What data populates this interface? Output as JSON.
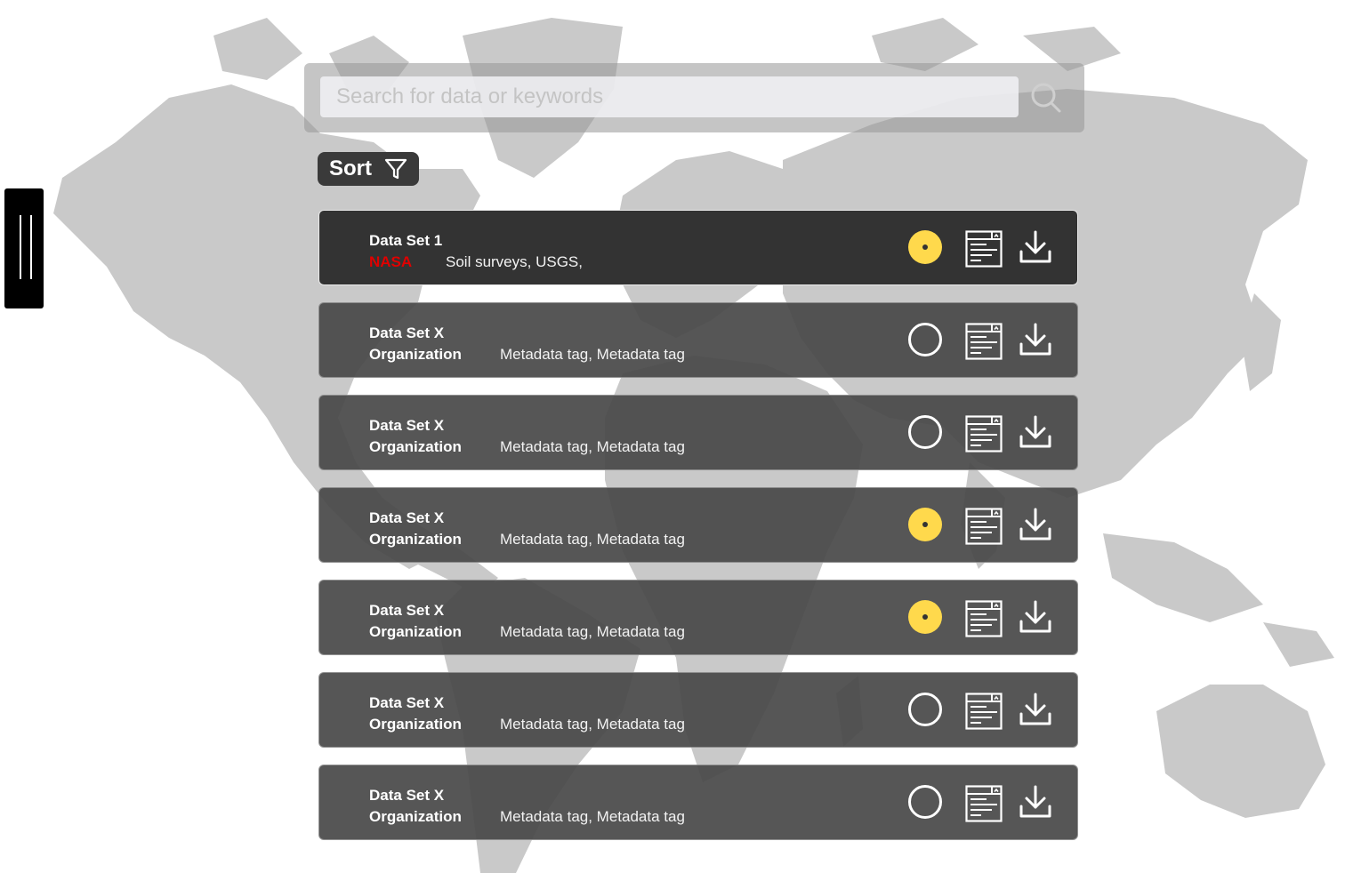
{
  "search": {
    "placeholder": "Search for data or keywords"
  },
  "sort": {
    "label": "Sort"
  },
  "colors": {
    "accent_selected": "#ffd94c",
    "org_highlight": "#e00000",
    "card_bg": "#484848",
    "card_active_bg": "#333333",
    "map_land": "#c9c9c9"
  },
  "datasets": [
    {
      "title": "Data Set 1",
      "organization": "NASA",
      "tags": "Soil surveys, USGS,",
      "selected": true,
      "active": true,
      "org_color": "#e00000"
    },
    {
      "title": "Data Set X",
      "organization": "Organization",
      "tags": "Metadata tag, Metadata tag",
      "selected": false,
      "active": false,
      "org_color": "#ffffff"
    },
    {
      "title": "Data Set X",
      "organization": "Organization",
      "tags": "Metadata tag, Metadata tag",
      "selected": false,
      "active": false,
      "org_color": "#ffffff"
    },
    {
      "title": "Data Set X",
      "organization": "Organization",
      "tags": "Metadata tag, Metadata tag",
      "selected": true,
      "active": false,
      "org_color": "#ffffff"
    },
    {
      "title": "Data Set X",
      "organization": "Organization",
      "tags": "Metadata tag, Metadata tag",
      "selected": true,
      "active": false,
      "org_color": "#ffffff"
    },
    {
      "title": "Data Set X",
      "organization": "Organization",
      "tags": "Metadata tag, Metadata tag",
      "selected": false,
      "active": false,
      "org_color": "#ffffff"
    },
    {
      "title": "Data Set X",
      "organization": "Organization",
      "tags": "Metadata tag, Metadata tag",
      "selected": false,
      "active": false,
      "org_color": "#ffffff"
    }
  ],
  "icons": {
    "search": "search-icon",
    "sort": "filter-icon",
    "select": "radio-icon",
    "details": "document-icon",
    "download": "download-icon",
    "handle": "drag-handle-icon"
  }
}
